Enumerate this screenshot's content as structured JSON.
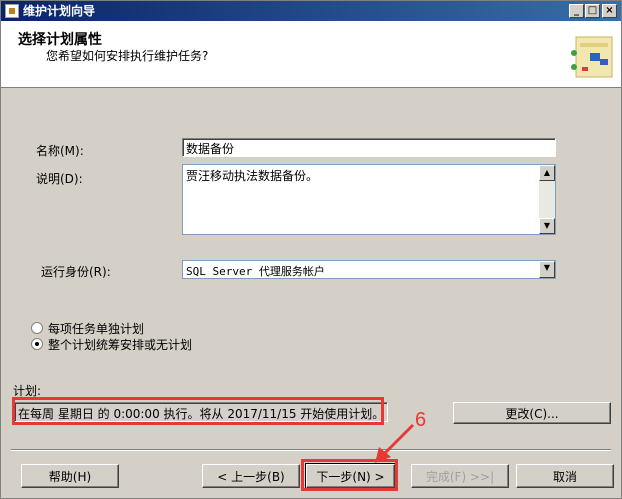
{
  "window": {
    "title": "维护计划向导",
    "controls": {
      "minimize": "_",
      "maximize": "□",
      "close": "×"
    }
  },
  "header": {
    "title": "选择计划属性",
    "subtitle": "您希望如何安排执行维护任务?"
  },
  "form": {
    "name_label": "名称(M):",
    "name_value": "数据备份",
    "desc_label": "说明(D):",
    "desc_value": "贾汪移动执法数据备份。",
    "runas_label": "运行身份(R):",
    "runas_value": "SQL Server 代理服务帐户"
  },
  "options": [
    {
      "label": "每项任务单独计划",
      "checked": false
    },
    {
      "label": "整个计划统筹安排或无计划",
      "checked": true
    }
  ],
  "schedule": {
    "label": "计划:",
    "text": "在每周 星期日 的 0:00:00 执行。将从 2017/11/15 开始使用计划。",
    "change_button": "更改(C)..."
  },
  "buttons": {
    "help": "帮助(H)",
    "back": "< 上一步(B)",
    "next": "下一步(N) >",
    "finish": "完成(F) >>|",
    "cancel": "取消"
  },
  "annotation": {
    "number": "6",
    "color": "#e53935"
  },
  "colors": {
    "title_start": "#0a246a",
    "title_end": "#3a6ea5",
    "face": "#d4d0c8"
  }
}
